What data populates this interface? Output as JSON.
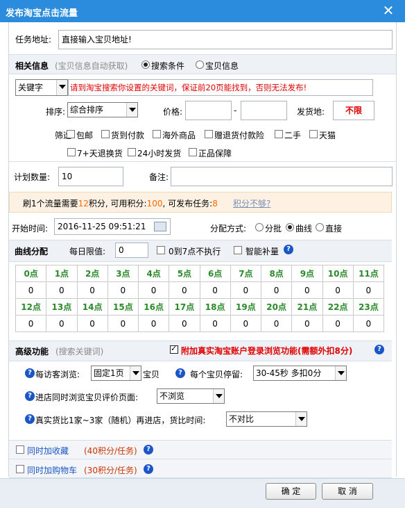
{
  "window": {
    "title": "发布淘宝点击流量"
  },
  "task": {
    "label": "任务地址:",
    "value": "直接输入宝贝地址!"
  },
  "related": {
    "title": "相关信息",
    "subtitle": "(宝贝信息自动获取)",
    "radio1": "搜索条件",
    "radio2": "宝贝信息",
    "keyword_select": "关键字",
    "keyword_hint": "请到淘宝搜索你设置的关键词，保证前20页能找到，否则无法发布!",
    "sort_label": "排序:",
    "sort_value": "综合排序",
    "price_label": "价格:",
    "price_dash": "-",
    "ship_label": "发货地:",
    "ship_value": "不限",
    "filter_label": "筛选:",
    "filters": [
      "包邮",
      "货到付款",
      "海外商品",
      "赠退货付款险",
      "二手",
      "天猫",
      "7+天退换货",
      "24小时发货",
      "正品保障"
    ]
  },
  "plan": {
    "label": "计划数量:",
    "value": "10",
    "note_label": "备注:"
  },
  "notice": {
    "p1": "刷1个流量需要",
    "need": "12",
    "p2": "积分, 可用积分:",
    "avail": "100",
    "p3": ", 可发布任务:",
    "tasks": "8",
    "link": "积分不够?"
  },
  "start": {
    "label": "开始时间:",
    "value": "2016-11-25 09:51:21"
  },
  "dist": {
    "label": "分配方式:",
    "opt1": "分批",
    "opt2": "曲线",
    "opt3": "直接"
  },
  "curve": {
    "title": "曲线分配",
    "limit_label": "每日限值:",
    "limit_value": "0",
    "skip_label": "0到7点不执行",
    "smart_label": "智能补量",
    "hours_row1": [
      "0点",
      "1点",
      "2点",
      "3点",
      "4点",
      "5点",
      "6点",
      "7点",
      "8点",
      "9点",
      "10点",
      "11点"
    ],
    "values_row1": [
      "0",
      "0",
      "0",
      "0",
      "0",
      "0",
      "0",
      "0",
      "0",
      "0",
      "0",
      "0"
    ],
    "hours_row2": [
      "12点",
      "13点",
      "14点",
      "15点",
      "16点",
      "17点",
      "18点",
      "19点",
      "20点",
      "21点",
      "22点",
      "23点"
    ],
    "values_row2": [
      "0",
      "0",
      "0",
      "0",
      "0",
      "0",
      "0",
      "0",
      "0",
      "0",
      "0",
      "0"
    ]
  },
  "advanced": {
    "title": "高级功能",
    "subtitle": "(搜索关键词)",
    "login_label": "附加真实淘宝账户登录浏览功能(需额外扣8分)",
    "visit_label": "每访客浏览:",
    "visit_value": "固定1页",
    "visit_unit": "宝贝",
    "stay_label": "每个宝贝停留:",
    "stay_value": "30-45秒 多扣0分",
    "review_label": "进店同时浏览宝贝评价页面:",
    "review_value": "不浏览",
    "compare_label": "真实货比1家~3家（随机）再进店，货比时间:",
    "compare_value": "不对比"
  },
  "extras": {
    "fav_label": "同时加收藏",
    "fav_cost": "(40积分/任务)",
    "cart_label": "同时加购物车",
    "cart_cost": "(30积分/任务)"
  },
  "buttons": {
    "ok": "确 定",
    "cancel": "取 消"
  }
}
